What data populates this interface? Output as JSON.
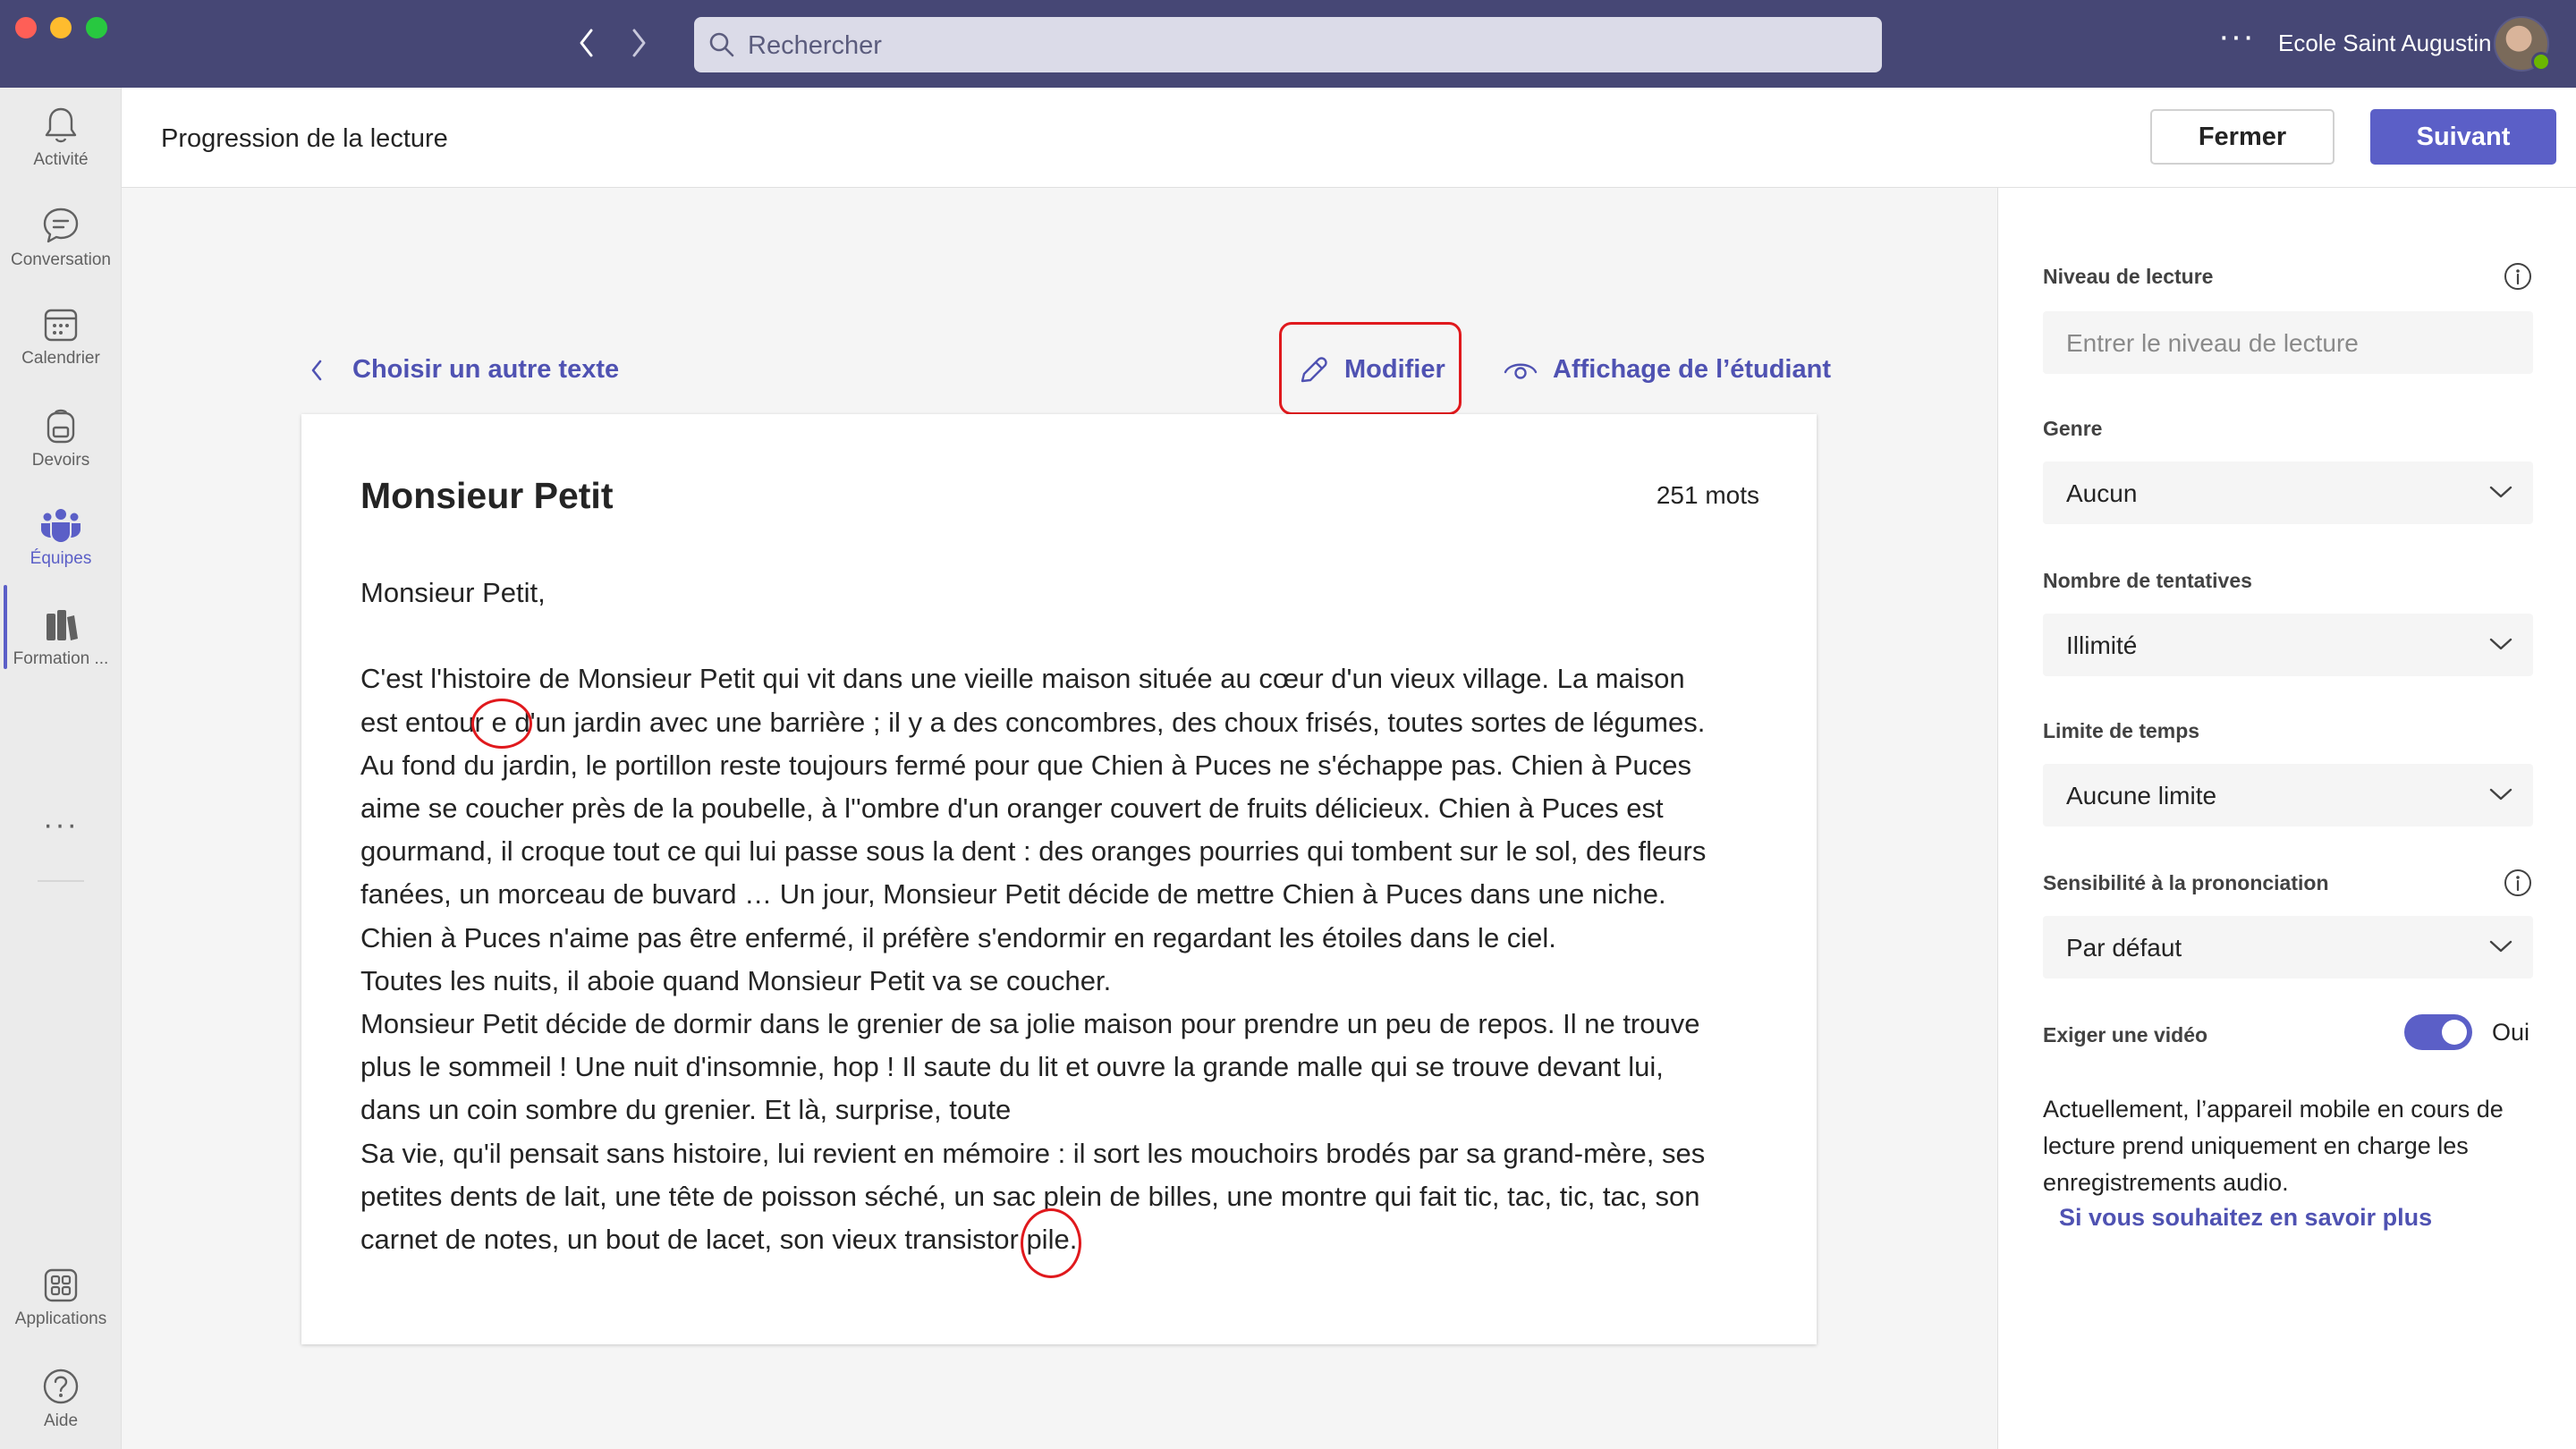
{
  "window": {
    "search_placeholder": "Rechercher",
    "more_label": "···",
    "org_name": "Ecole Saint Augustin"
  },
  "rail": {
    "items": [
      {
        "label": "Activité",
        "icon": "bell-icon"
      },
      {
        "label": "Conversation",
        "icon": "chat-icon"
      },
      {
        "label": "Calendrier",
        "icon": "calendar-icon"
      },
      {
        "label": "Devoirs",
        "icon": "backpack-icon"
      },
      {
        "label": "Équipes",
        "icon": "teams-icon"
      },
      {
        "label": "Formation ...",
        "icon": "books-icon"
      },
      {
        "label": "Applications",
        "icon": "apps-icon"
      },
      {
        "label": "Aide",
        "icon": "help-icon"
      }
    ],
    "more_label": "···",
    "active": "Équipes"
  },
  "header": {
    "title": "Progression de la lecture",
    "close_label": "Fermer",
    "next_label": "Suivant"
  },
  "main": {
    "back_label": "Choisir un autre texte",
    "edit_label": "Modifier",
    "student_view_label": "Affichage de l’étudiant",
    "card": {
      "title": "Monsieur Petit",
      "word_count": "251 mots",
      "lines": [
        "Monsieur Petit,",
        "",
        "C'est l'histoire de Monsieur Petit qui vit dans une vieille maison située au cœur d'un vieux village. La maison",
        "est entour  e d'un jardin avec une barrière ; il y a des concombres, des choux frisés, toutes sortes de légumes.",
        "Au fond du jardin, le portillon reste toujours fermé pour que Chien à Puces ne s'échappe pas. Chien à Puces",
        "aime se coucher près de la poubelle, à l''ombre d'un oranger couvert de fruits délicieux. Chien à Puces est",
        "gourmand, il croque tout ce qui lui passe sous la dent : des oranges pourries qui tombent sur le sol, des fleurs",
        "fanées, un morceau de buvard … Un jour, Monsieur Petit décide de mettre Chien à Puces dans une niche.",
        "Chien à Puces n'aime pas être enfermé, il préfère s'endormir en regardant les étoiles dans le ciel.",
        "Toutes les nuits, il aboie quand Monsieur Petit va se coucher.",
        "Monsieur Petit décide de dormir dans le grenier de sa jolie maison pour prendre un peu de repos. Il ne trouve",
        "plus le sommeil ! Une nuit d'insomnie, hop ! Il saute du lit et ouvre la grande malle qui se trouve devant lui,",
        "dans un coin sombre du grenier. Et là, surprise, toute",
        "Sa vie, qu'il pensait sans histoire, lui revient en mémoire : il sort les mouchoirs brodés par sa grand-mère, ses",
        "petites dents de lait, une tête de poisson séché, un sac plein de billes, une montre qui fait tic, tac, tic, tac, son",
        "carnet de notes, un bout de lacet, son vieux transistor    pile."
      ]
    }
  },
  "panel": {
    "reading_level": {
      "label": "Niveau de lecture",
      "placeholder": "Entrer le niveau de lecture"
    },
    "genre": {
      "label": "Genre",
      "value": "Aucun"
    },
    "attempts": {
      "label": "Nombre de tentatives",
      "value": "Illimité"
    },
    "time_limit": {
      "label": "Limite de temps",
      "value": "Aucune limite"
    },
    "sensitivity": {
      "label": "Sensibilité à la prononciation",
      "value": "Par défaut"
    },
    "video": {
      "label": "Exiger une vidéo",
      "state": "Oui",
      "on": true
    },
    "note": "Actuellement, l’appareil mobile en cours de lecture prend uniquement en charge les enregistrements audio.",
    "learn_more": "Si vous souhaitez en savoir plus"
  },
  "colors": {
    "titlebar": "#464775",
    "accent": "#5b5fc7",
    "link": "#4f52b2",
    "annotation": "#e0191d"
  }
}
